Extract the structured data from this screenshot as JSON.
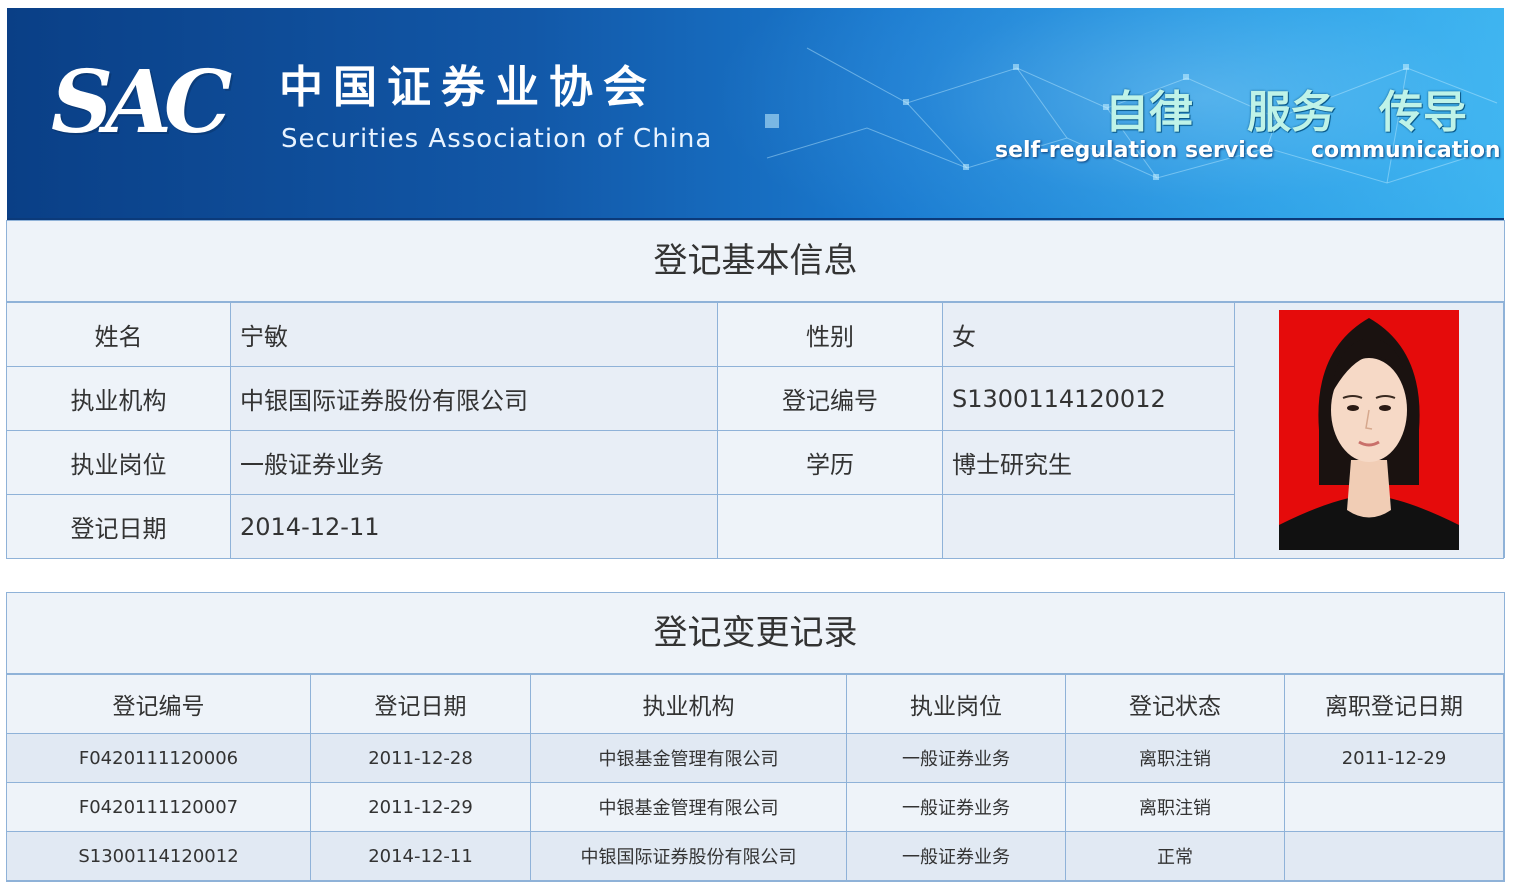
{
  "header": {
    "logo_text": "SAC",
    "org_name_cn": "中国证券业协会",
    "org_name_en": "Securities Association of China",
    "slogans": [
      {
        "cn": "自律",
        "en": "self-regulation"
      },
      {
        "cn": "服务",
        "en": "service"
      },
      {
        "cn": "传导",
        "en": "communication"
      }
    ]
  },
  "basic_info": {
    "title": "登记基本信息",
    "rows": [
      {
        "label1": "姓名",
        "value1": "宁敏",
        "label2": "性别",
        "value2": "女"
      },
      {
        "label1": "执业机构",
        "value1": "中银国际证券股份有限公司",
        "label2": "登记编号",
        "value2": "S1300114120012"
      },
      {
        "label1": "执业岗位",
        "value1": "一般证券业务",
        "label2": "学历",
        "value2": "博士研究生"
      },
      {
        "label1": "登记日期",
        "value1": "2014-12-11",
        "label2": "",
        "value2": ""
      }
    ]
  },
  "change_records": {
    "title": "登记变更记录",
    "columns": [
      "登记编号",
      "登记日期",
      "执业机构",
      "执业岗位",
      "登记状态",
      "离职登记日期"
    ],
    "rows": [
      [
        "F0420111120006",
        "2011-12-28",
        "中银基金管理有限公司",
        "一般证券业务",
        "离职注销",
        "2011-12-29"
      ],
      [
        "F0420111120007",
        "2011-12-29",
        "中银基金管理有限公司",
        "一般证券业务",
        "离职注销",
        ""
      ],
      [
        "S1300114120012",
        "2014-12-11",
        "中银国际证券股份有限公司",
        "一般证券业务",
        "正常",
        ""
      ]
    ]
  },
  "colors": {
    "banner_dark": "#0a3f86",
    "banner_light": "#3ab3ef",
    "table_border": "#8fb2d8",
    "table_bg": "#eef3f9",
    "photo_bg": "#e50b0b"
  }
}
